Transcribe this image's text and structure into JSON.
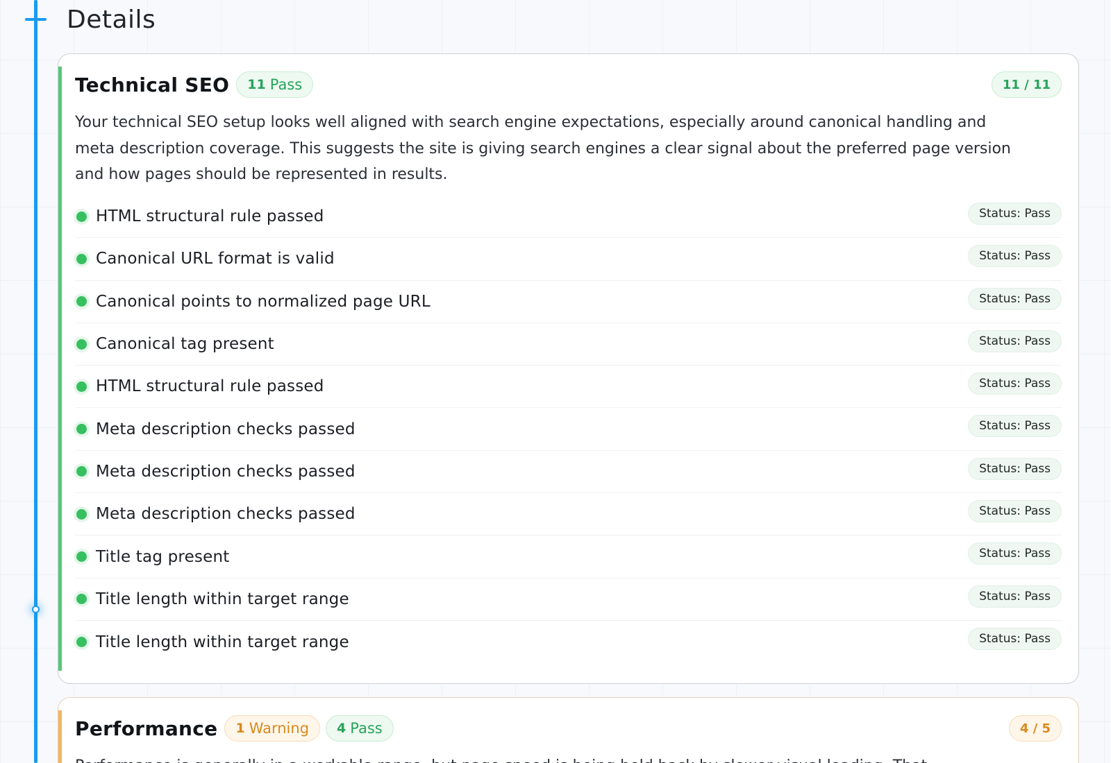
{
  "section": {
    "title": "Details"
  },
  "colors": {
    "timeline": "#1a9bef",
    "pass": "#28a35a",
    "warning": "#d88a1c"
  },
  "technical_seo": {
    "title": "Technical SEO",
    "badges": [
      {
        "count": "11",
        "label": "Pass"
      }
    ],
    "score": "11 / 11",
    "description": "Your technical SEO setup looks well aligned with search engine expectations, especially around canonical handling and meta description coverage. This suggests the site is giving search engines a clear signal about the preferred page version and how pages should be represented in results.",
    "checks": [
      {
        "label": "HTML structural rule passed",
        "status": "Status: Pass"
      },
      {
        "label": "Canonical URL format is valid",
        "status": "Status: Pass"
      },
      {
        "label": "Canonical points to normalized page URL",
        "status": "Status: Pass"
      },
      {
        "label": "Canonical tag present",
        "status": "Status: Pass"
      },
      {
        "label": "HTML structural rule passed",
        "status": "Status: Pass"
      },
      {
        "label": "Meta description checks passed",
        "status": "Status: Pass"
      },
      {
        "label": "Meta description checks passed",
        "status": "Status: Pass"
      },
      {
        "label": "Meta description checks passed",
        "status": "Status: Pass"
      },
      {
        "label": "Title tag present",
        "status": "Status: Pass"
      },
      {
        "label": "Title length within target range",
        "status": "Status: Pass"
      },
      {
        "label": "Title length within target range",
        "status": "Status: Pass"
      }
    ]
  },
  "performance": {
    "title": "Performance",
    "badges": [
      {
        "count": "1",
        "label": "Warning"
      },
      {
        "count": "4",
        "label": "Pass"
      }
    ],
    "score": "4 / 5",
    "description": "Performance is generally in a workable range, but page speed is being held back by slower visual loading. That"
  }
}
